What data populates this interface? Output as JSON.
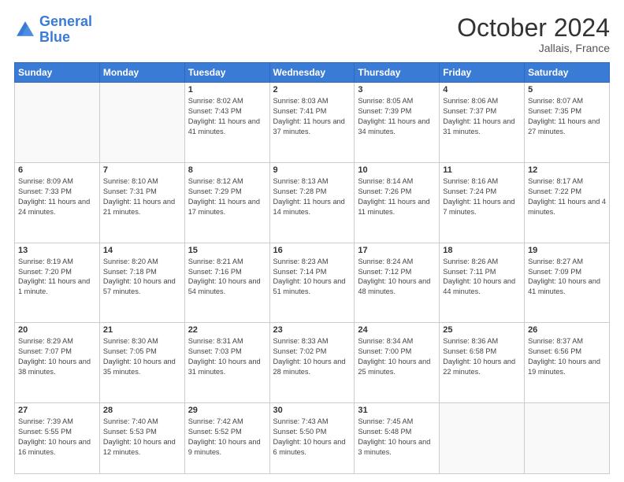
{
  "header": {
    "logo_text_general": "General",
    "logo_text_blue": "Blue",
    "month": "October 2024",
    "location": "Jallais, France"
  },
  "weekdays": [
    "Sunday",
    "Monday",
    "Tuesday",
    "Wednesday",
    "Thursday",
    "Friday",
    "Saturday"
  ],
  "weeks": [
    [
      {
        "day": "",
        "info": ""
      },
      {
        "day": "",
        "info": ""
      },
      {
        "day": "1",
        "info": "Sunrise: 8:02 AM\nSunset: 7:43 PM\nDaylight: 11 hours and 41 minutes."
      },
      {
        "day": "2",
        "info": "Sunrise: 8:03 AM\nSunset: 7:41 PM\nDaylight: 11 hours and 37 minutes."
      },
      {
        "day": "3",
        "info": "Sunrise: 8:05 AM\nSunset: 7:39 PM\nDaylight: 11 hours and 34 minutes."
      },
      {
        "day": "4",
        "info": "Sunrise: 8:06 AM\nSunset: 7:37 PM\nDaylight: 11 hours and 31 minutes."
      },
      {
        "day": "5",
        "info": "Sunrise: 8:07 AM\nSunset: 7:35 PM\nDaylight: 11 hours and 27 minutes."
      }
    ],
    [
      {
        "day": "6",
        "info": "Sunrise: 8:09 AM\nSunset: 7:33 PM\nDaylight: 11 hours and 24 minutes."
      },
      {
        "day": "7",
        "info": "Sunrise: 8:10 AM\nSunset: 7:31 PM\nDaylight: 11 hours and 21 minutes."
      },
      {
        "day": "8",
        "info": "Sunrise: 8:12 AM\nSunset: 7:29 PM\nDaylight: 11 hours and 17 minutes."
      },
      {
        "day": "9",
        "info": "Sunrise: 8:13 AM\nSunset: 7:28 PM\nDaylight: 11 hours and 14 minutes."
      },
      {
        "day": "10",
        "info": "Sunrise: 8:14 AM\nSunset: 7:26 PM\nDaylight: 11 hours and 11 minutes."
      },
      {
        "day": "11",
        "info": "Sunrise: 8:16 AM\nSunset: 7:24 PM\nDaylight: 11 hours and 7 minutes."
      },
      {
        "day": "12",
        "info": "Sunrise: 8:17 AM\nSunset: 7:22 PM\nDaylight: 11 hours and 4 minutes."
      }
    ],
    [
      {
        "day": "13",
        "info": "Sunrise: 8:19 AM\nSunset: 7:20 PM\nDaylight: 11 hours and 1 minute."
      },
      {
        "day": "14",
        "info": "Sunrise: 8:20 AM\nSunset: 7:18 PM\nDaylight: 10 hours and 57 minutes."
      },
      {
        "day": "15",
        "info": "Sunrise: 8:21 AM\nSunset: 7:16 PM\nDaylight: 10 hours and 54 minutes."
      },
      {
        "day": "16",
        "info": "Sunrise: 8:23 AM\nSunset: 7:14 PM\nDaylight: 10 hours and 51 minutes."
      },
      {
        "day": "17",
        "info": "Sunrise: 8:24 AM\nSunset: 7:12 PM\nDaylight: 10 hours and 48 minutes."
      },
      {
        "day": "18",
        "info": "Sunrise: 8:26 AM\nSunset: 7:11 PM\nDaylight: 10 hours and 44 minutes."
      },
      {
        "day": "19",
        "info": "Sunrise: 8:27 AM\nSunset: 7:09 PM\nDaylight: 10 hours and 41 minutes."
      }
    ],
    [
      {
        "day": "20",
        "info": "Sunrise: 8:29 AM\nSunset: 7:07 PM\nDaylight: 10 hours and 38 minutes."
      },
      {
        "day": "21",
        "info": "Sunrise: 8:30 AM\nSunset: 7:05 PM\nDaylight: 10 hours and 35 minutes."
      },
      {
        "day": "22",
        "info": "Sunrise: 8:31 AM\nSunset: 7:03 PM\nDaylight: 10 hours and 31 minutes."
      },
      {
        "day": "23",
        "info": "Sunrise: 8:33 AM\nSunset: 7:02 PM\nDaylight: 10 hours and 28 minutes."
      },
      {
        "day": "24",
        "info": "Sunrise: 8:34 AM\nSunset: 7:00 PM\nDaylight: 10 hours and 25 minutes."
      },
      {
        "day": "25",
        "info": "Sunrise: 8:36 AM\nSunset: 6:58 PM\nDaylight: 10 hours and 22 minutes."
      },
      {
        "day": "26",
        "info": "Sunrise: 8:37 AM\nSunset: 6:56 PM\nDaylight: 10 hours and 19 minutes."
      }
    ],
    [
      {
        "day": "27",
        "info": "Sunrise: 7:39 AM\nSunset: 5:55 PM\nDaylight: 10 hours and 16 minutes."
      },
      {
        "day": "28",
        "info": "Sunrise: 7:40 AM\nSunset: 5:53 PM\nDaylight: 10 hours and 12 minutes."
      },
      {
        "day": "29",
        "info": "Sunrise: 7:42 AM\nSunset: 5:52 PM\nDaylight: 10 hours and 9 minutes."
      },
      {
        "day": "30",
        "info": "Sunrise: 7:43 AM\nSunset: 5:50 PM\nDaylight: 10 hours and 6 minutes."
      },
      {
        "day": "31",
        "info": "Sunrise: 7:45 AM\nSunset: 5:48 PM\nDaylight: 10 hours and 3 minutes."
      },
      {
        "day": "",
        "info": ""
      },
      {
        "day": "",
        "info": ""
      }
    ]
  ]
}
